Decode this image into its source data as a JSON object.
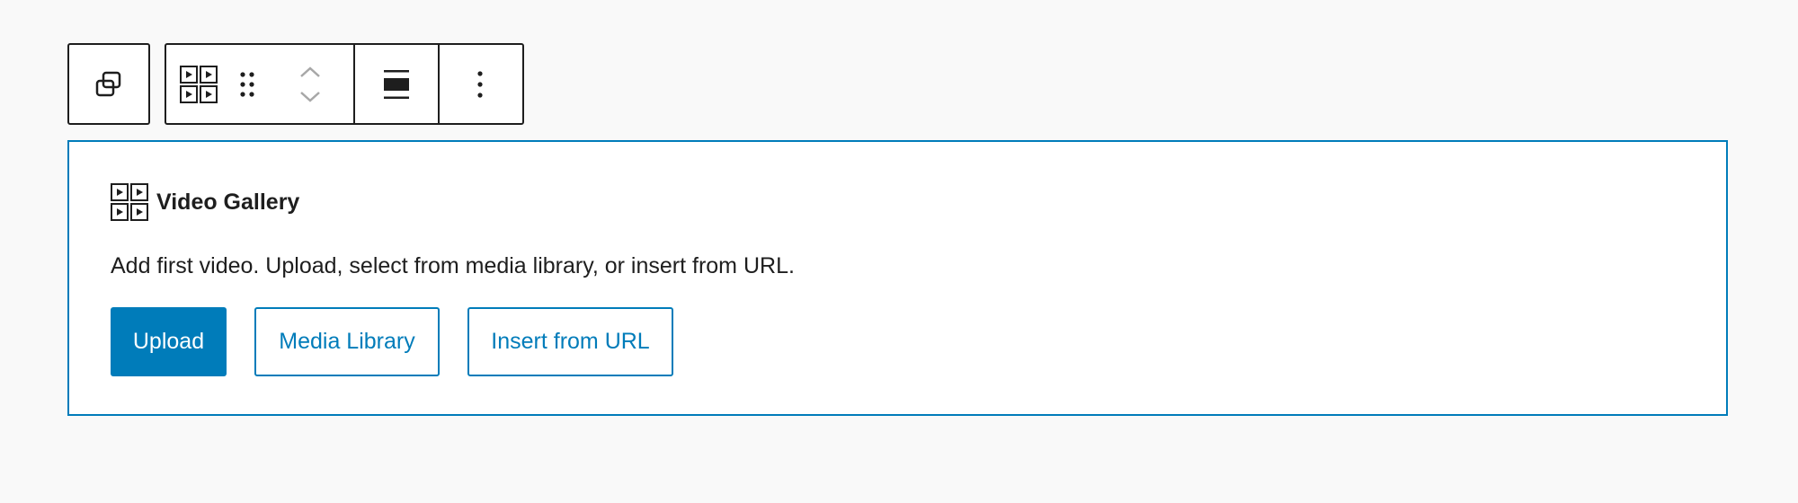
{
  "toolbar": {
    "transform": {
      "icon": "copy-transform-icon"
    },
    "block_type": {
      "icon": "video-gallery-icon"
    },
    "drag": {
      "icon": "drag-handle-icon"
    },
    "move_up": {
      "icon": "chevron-up-icon"
    },
    "move_down": {
      "icon": "chevron-down-icon"
    },
    "align": {
      "icon": "align-wide-icon"
    },
    "more": {
      "icon": "more-vertical-icon"
    }
  },
  "block": {
    "icon": "video-gallery-icon",
    "title": "Video Gallery",
    "instructions": "Add first video. Upload, select from media library, or insert from URL.",
    "actions": {
      "upload_label": "Upload",
      "media_library_label": "Media Library",
      "insert_url_label": "Insert from URL"
    }
  },
  "colors": {
    "accent": "#007cba",
    "text": "#1e1e1e",
    "background": "#f9f9f9"
  }
}
